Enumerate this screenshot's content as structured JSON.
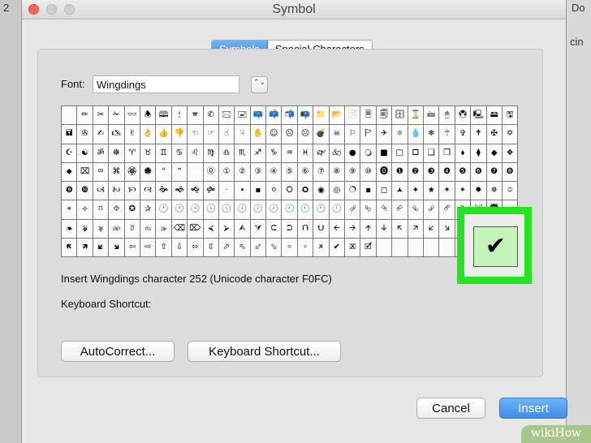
{
  "window": {
    "title": "Symbol"
  },
  "background": {
    "top_left_digit": "2",
    "top_right_text": "Do",
    "second_right_text": "cin"
  },
  "tabs": {
    "symbols": "Symbols",
    "special": "Special Characters"
  },
  "font": {
    "label": "Font:",
    "value": "Wingdings",
    "stepper_glyph": "⌃⌄"
  },
  "symbol_grid": {
    "columns": 29,
    "rows": [
      [
        "",
        "✏",
        "✂",
        "✁",
        "👓",
        "🕭",
        "🕮",
        "🕯",
        "🕿",
        "✆",
        "🖂",
        "🖃",
        "📪",
        "📫",
        "📬",
        "📭",
        "📁",
        "📂",
        "📄",
        "🗏",
        "🗐",
        "🗄",
        "⌛",
        "🖮",
        "🖰",
        "🖲",
        "🖳",
        "🖴",
        "🖫"
      ],
      [
        "🖬",
        "✇",
        "✍",
        "🖎",
        "✌",
        "👌",
        "👍",
        "👎",
        "☜",
        "☞",
        "☝",
        "☟",
        "✋",
        "☺",
        "😐",
        "☹",
        "💣",
        "☠",
        "⚐",
        "🏱",
        "✈",
        "☼",
        "💧",
        "❄",
        "🕆",
        "✞",
        "🕈",
        "✠",
        "✡"
      ],
      [
        "☪",
        "☯",
        "ॐ",
        "☸",
        "♈",
        "♉",
        "♊",
        "♋",
        "♌",
        "♍",
        "♎",
        "♏",
        "♐",
        "♑",
        "♒",
        "♓",
        "🙰",
        "🙵",
        "●",
        "🔾",
        "■",
        "□",
        "🞐",
        "❑",
        "❒",
        "⬧",
        "⧫",
        "◆",
        "❖"
      ],
      [
        "⬥",
        "⌧",
        "⮹",
        "⌘",
        "🏵",
        "🏶",
        "🙶",
        "🙷",
        "",
        "⓪",
        "①",
        "②",
        "③",
        "④",
        "⑤",
        "⑥",
        "⑦",
        "⑧",
        "⑨",
        "⑩",
        "⓿",
        "❶",
        "❷",
        "❸",
        "❹",
        "❺",
        "❻",
        "❼",
        "❽"
      ],
      [
        "❾",
        "❿",
        "🙢",
        "🙠",
        "🙡",
        "🙣",
        "🙞",
        "🙜",
        "🙝",
        "🙟",
        "·",
        "•",
        "▪",
        "⚪",
        "🞆",
        "🞈",
        "◉",
        "◎",
        "🔿",
        "▪",
        "◻",
        "🟂",
        "✦",
        "★",
        "✶",
        "✴",
        "✹",
        "✵",
        "⯐"
      ],
      [
        "⌖",
        "⟡",
        "⌑",
        "⯑",
        "✪",
        "✰",
        "🕐",
        "🕑",
        "🕒",
        "🕓",
        "🕔",
        "🕕",
        "🕖",
        "🕗",
        "🕘",
        "🕙",
        "🕚",
        "🕛",
        "⮰",
        "⮱",
        "⮲",
        "⮳",
        "⮴",
        "⮵",
        "⮶",
        "⮷",
        "🙪",
        "🙫",
        "🙕"
      ],
      [
        "🙔",
        "🙗",
        "🙖",
        "🙐",
        "🙑",
        "🙒",
        "🙓",
        "⌫",
        "⌦",
        "⮘",
        "⮚",
        "⮙",
        "⮛",
        "⮈",
        "⮊",
        "⮉",
        "⮋",
        "🡨",
        "🡪",
        "🡩",
        "🡫",
        "🡬",
        "🡭",
        "🡯",
        "🡮",
        "🡸",
        "🡺",
        "🡹",
        "🡻"
      ],
      [
        "🡼",
        "🡽",
        "🡿",
        "🡾",
        "⇦",
        "⇨",
        "⇧",
        "⇩",
        "⬄",
        "⇳",
        "⬀",
        "⬁",
        "⬃",
        "⬂",
        "🢬",
        "🢭",
        "🗶",
        "✔",
        "🗷",
        "🗹",
        "",
        "",
        "",
        "",
        "",
        "",
        "",
        "",
        ""
      ]
    ]
  },
  "info": {
    "insert_text": "Insert Wingdings character 252  (Unicode character F0FC)",
    "shortcut_label": "Keyboard Shortcut:"
  },
  "buttons": {
    "autocorrect": "AutoCorrect...",
    "keyboard_shortcut": "Keyboard Shortcut...",
    "cancel": "Cancel",
    "insert": "Insert"
  },
  "highlight": {
    "glyph": "✔",
    "border_color": "#22e51e",
    "fill_color": "#c4f3b6"
  },
  "colors": {
    "accent": "#3f8ee8",
    "close": "#fc605c"
  },
  "watermark": {
    "text": "wikiHow"
  }
}
